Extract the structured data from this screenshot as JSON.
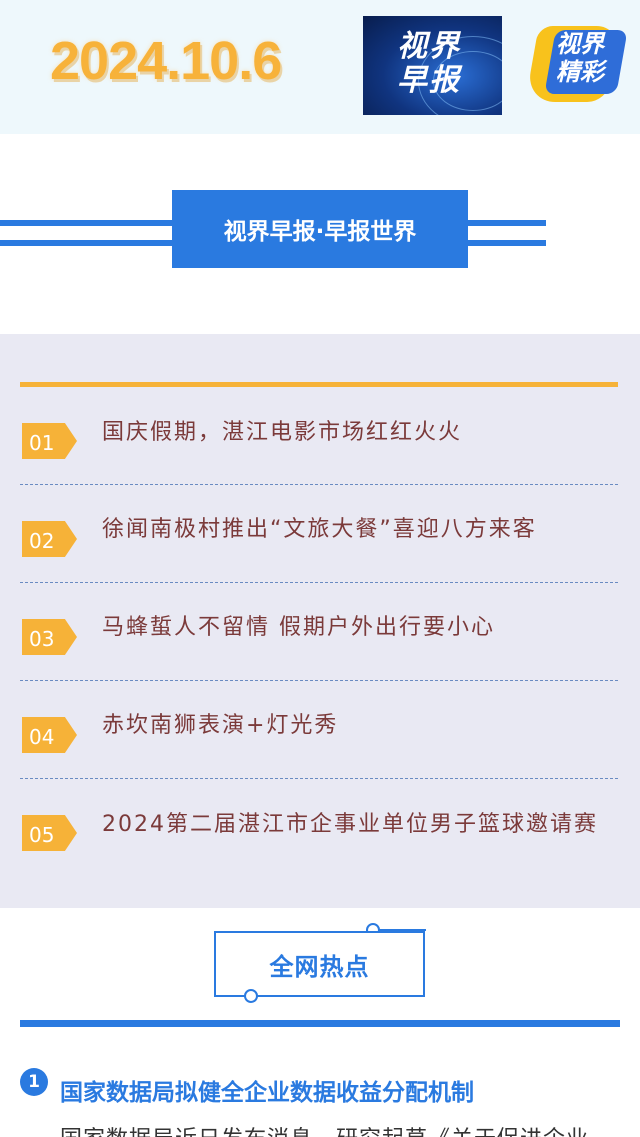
{
  "header": {
    "date": "2024.10.6",
    "logo_line1": "视界",
    "logo_line2": "早报",
    "badge_line1": "视界",
    "badge_line2": "精彩"
  },
  "section_title": "视界早报·早报世界",
  "news": [
    {
      "num": "01",
      "text": "国庆假期，湛江电影市场红红火火"
    },
    {
      "num": "02",
      "text": "徐闻南极村推出“文旅大餐”喜迎八方来客"
    },
    {
      "num": "03",
      "text": "马蜂蜇人不留情  假期户外出行要小心"
    },
    {
      "num": "04",
      "text": "赤坎南狮表演+灯光秀"
    },
    {
      "num": "05",
      "text": "2024第二届湛江市企事业单位男子篮球邀请赛"
    }
  ],
  "hot": {
    "title": "全网热点"
  },
  "article": {
    "num": "1",
    "title": "国家数据局拟健全企业数据收益分配机制",
    "body": "国家数据局近日发布消息，研究起草《关于促进企业"
  },
  "colors": {
    "accent_blue": "#2a7ae0",
    "accent_orange": "#f6b238",
    "news_text": "#7b3a3a"
  }
}
